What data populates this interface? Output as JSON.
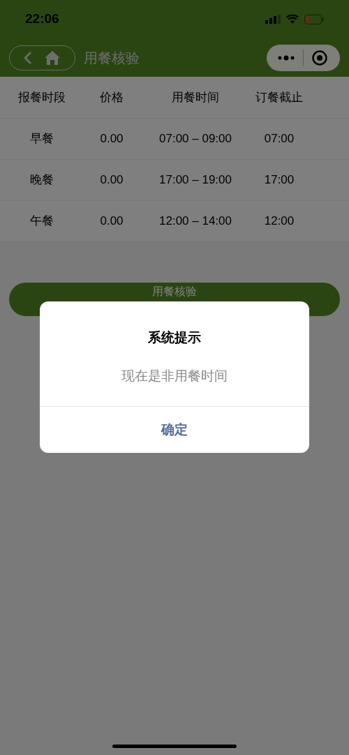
{
  "status_bar": {
    "time": "22:06"
  },
  "nav_bar": {
    "title": "用餐核验"
  },
  "table": {
    "columns": [
      "报餐时段",
      "价格",
      "用餐时间",
      "订餐截止"
    ],
    "rows": [
      [
        "早餐",
        "0.00",
        "07:00 – 09:00",
        "07:00"
      ],
      [
        "晚餐",
        "0.00",
        "17:00 – 19:00",
        "17:00"
      ],
      [
        "午餐",
        "0.00",
        "12:00 – 14:00",
        "12:00"
      ]
    ]
  },
  "action_button": {
    "label": "用餐核验"
  },
  "dialog": {
    "title": "系统提示",
    "message": "现在是非用餐时间",
    "confirm": "确定"
  }
}
